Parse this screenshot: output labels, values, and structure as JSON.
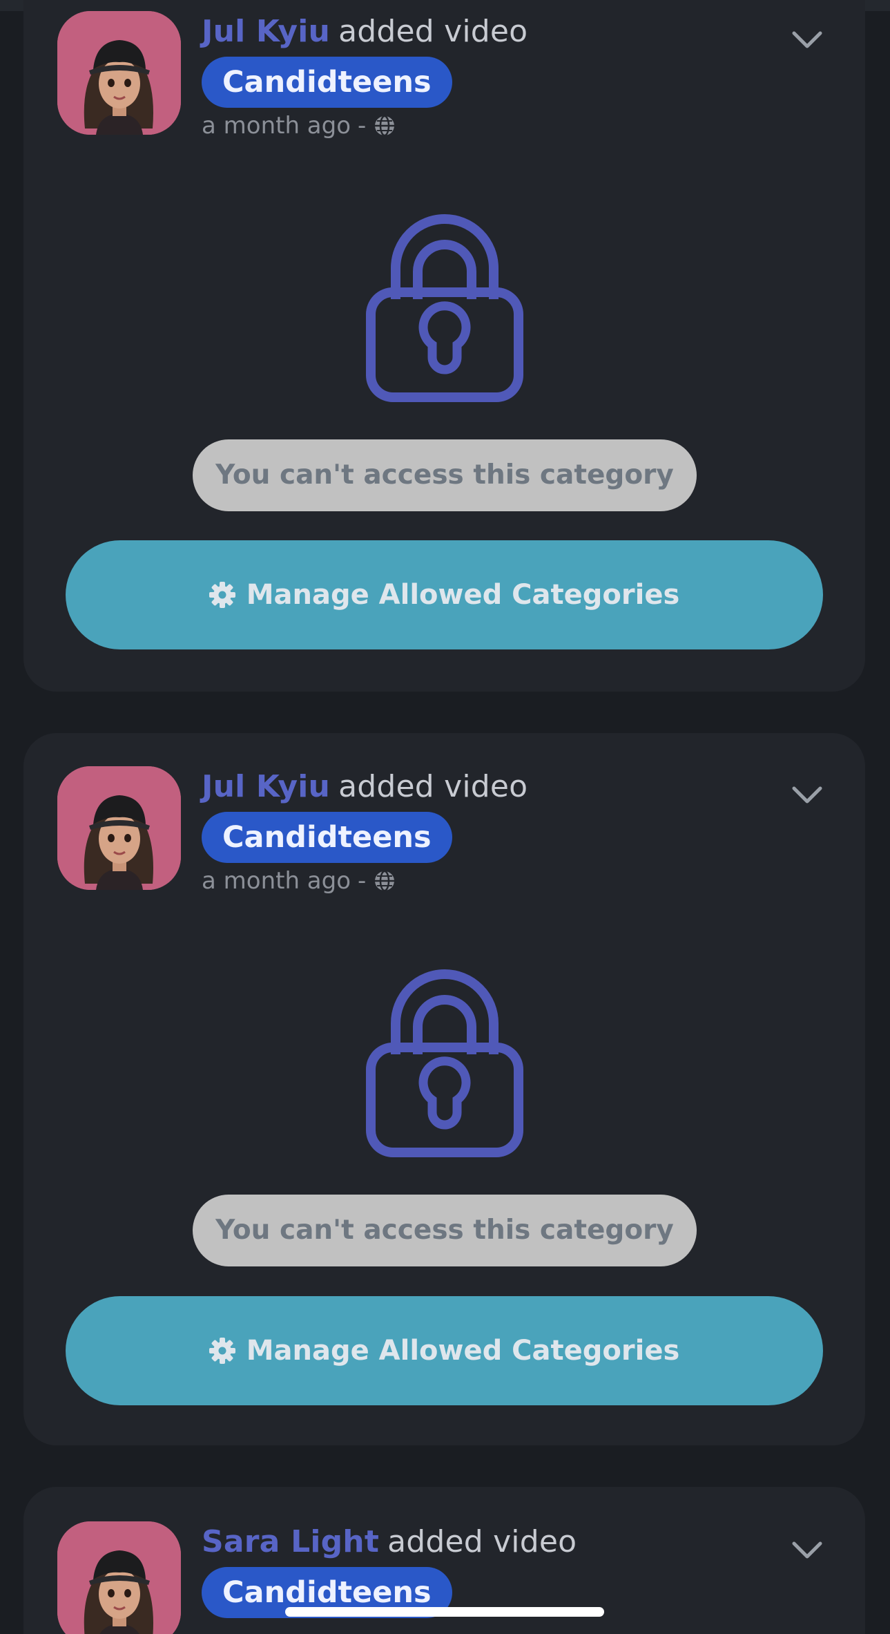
{
  "feed": {
    "posts": [
      {
        "author": "Jul Kyiu",
        "action": "added video",
        "category": "Candidteens",
        "time": "a month ago",
        "separator": "-",
        "notice": "You can't access this category",
        "button_label": "Manage Allowed Categories"
      },
      {
        "author": "Jul Kyiu",
        "action": "added video",
        "category": "Candidteens",
        "time": "a month ago",
        "separator": "-",
        "notice": "You can't access this category",
        "button_label": "Manage Allowed Categories"
      },
      {
        "author": "Sara Light",
        "action": "added video",
        "category": "Candidteens"
      }
    ]
  },
  "icons": {
    "visibility": "globe-icon",
    "expand": "chevron-down-icon",
    "locked": "lock-icon",
    "settings": "gear-icon"
  },
  "colors": {
    "background": "#1a1d22",
    "card": "#22252b",
    "author": "#5865c6",
    "category_pill": "#2a58c8",
    "lock": "#5059b8",
    "notice_pill": "#c1c1c1",
    "manage_button": "#4aa3bb",
    "avatar_bg": "#c2607f"
  }
}
